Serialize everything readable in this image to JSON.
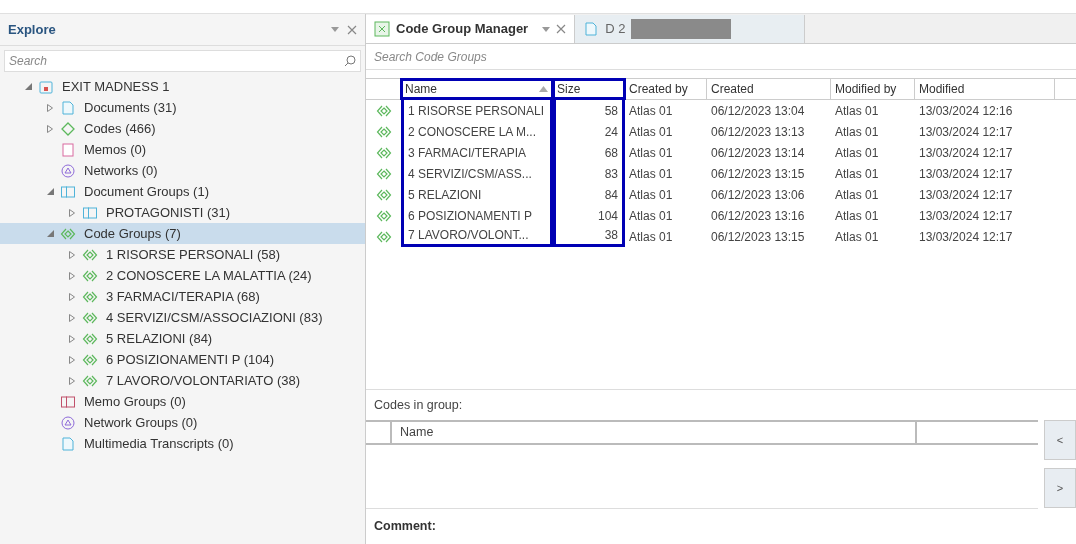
{
  "explore": {
    "title": "Explore",
    "search": {
      "placeholder": "Search"
    },
    "tree": [
      {
        "label": "EXIT MADNESS 1",
        "kind": "project",
        "expanded": true,
        "selected": false,
        "children": [
          {
            "label": "Documents (31)",
            "kind": "document",
            "expanded": false,
            "selected": false
          },
          {
            "label": "Codes (466)",
            "kind": "code",
            "expanded": false,
            "selected": false
          },
          {
            "label": "Memos (0)",
            "kind": "memo",
            "selected": false
          },
          {
            "label": "Networks (0)",
            "kind": "network",
            "selected": false
          },
          {
            "label": "Document Groups (1)",
            "kind": "document-group",
            "expanded": true,
            "selected": false,
            "children": [
              {
                "label": "PROTAGONISTI (31)",
                "kind": "document-group",
                "expanded": false,
                "selected": false
              }
            ]
          },
          {
            "label": "Code Groups (7)",
            "kind": "code-group",
            "expanded": true,
            "selected": true,
            "children": [
              {
                "label": "1 RISORSE PERSONALI (58)",
                "kind": "code-group",
                "expanded": false,
                "selected": false
              },
              {
                "label": "2 CONOSCERE LA MALATTIA (24)",
                "kind": "code-group",
                "expanded": false,
                "selected": false
              },
              {
                "label": "3 FARMACI/TERAPIA (68)",
                "kind": "code-group",
                "expanded": false,
                "selected": false
              },
              {
                "label": "4 SERVIZI/CSM/ASSOCIAZIONI (83)",
                "kind": "code-group",
                "expanded": false,
                "selected": false
              },
              {
                "label": "5 RELAZIONI (84)",
                "kind": "code-group",
                "expanded": false,
                "selected": false
              },
              {
                "label": "6 POSIZIONAMENTI P (104)",
                "kind": "code-group",
                "expanded": false,
                "selected": false
              },
              {
                "label": "7 LAVORO/VOLONTARIATO (38)",
                "kind": "code-group",
                "expanded": false,
                "selected": false
              }
            ]
          },
          {
            "label": "Memo Groups (0)",
            "kind": "memo-group",
            "selected": false
          },
          {
            "label": "Network Groups (0)",
            "kind": "network-group",
            "selected": false
          },
          {
            "label": "Multimedia Transcripts (0)",
            "kind": "transcript",
            "selected": false
          }
        ]
      }
    ]
  },
  "tabs": [
    {
      "label": "Code Group Manager",
      "kind": "manager",
      "selected": true
    },
    {
      "label": "D 2",
      "kind": "document",
      "selected": false
    }
  ],
  "search": {
    "placeholder": "Search Code Groups"
  },
  "table": {
    "columns": [
      {
        "label": "Name",
        "sorted": true,
        "highlighted": true
      },
      {
        "label": "Size",
        "sorted": false,
        "highlighted": true
      },
      {
        "label": "Created by",
        "sorted": false,
        "highlighted": false
      },
      {
        "label": "Created",
        "sorted": false,
        "highlighted": false
      },
      {
        "label": "Modified by",
        "sorted": false,
        "highlighted": false
      },
      {
        "label": "Modified",
        "sorted": false,
        "highlighted": false
      }
    ],
    "rows": [
      [
        "1 RISORSE PERSONALI",
        "58",
        "Atlas 01",
        "06/12/2023 13:04",
        "Atlas 01",
        "13/03/2024 12:16"
      ],
      [
        "2 CONOSCERE LA M...",
        "24",
        "Atlas 01",
        "06/12/2023 13:13",
        "Atlas 01",
        "13/03/2024 12:17"
      ],
      [
        "3 FARMACI/TERAPIA",
        "68",
        "Atlas 01",
        "06/12/2023 13:14",
        "Atlas 01",
        "13/03/2024 12:17"
      ],
      [
        "4 SERVIZI/CSM/ASS...",
        "83",
        "Atlas 01",
        "06/12/2023 13:15",
        "Atlas 01",
        "13/03/2024 12:17"
      ],
      [
        "5 RELAZIONI",
        "84",
        "Atlas 01",
        "06/12/2023 13:06",
        "Atlas 01",
        "13/03/2024 12:17"
      ],
      [
        "6 POSIZIONAMENTI P",
        "104",
        "Atlas 01",
        "06/12/2023 13:16",
        "Atlas 01",
        "13/03/2024 12:17"
      ],
      [
        "7 LAVORO/VOLONT...",
        "38",
        "Atlas 01",
        "06/12/2023 13:15",
        "Atlas 01",
        "13/03/2024 12:17"
      ]
    ]
  },
  "codes_in_group": {
    "title": "Codes in group:",
    "columns": [
      "Name"
    ],
    "buttons": [
      "<",
      ">"
    ]
  },
  "comment": {
    "label": "Comment:"
  }
}
